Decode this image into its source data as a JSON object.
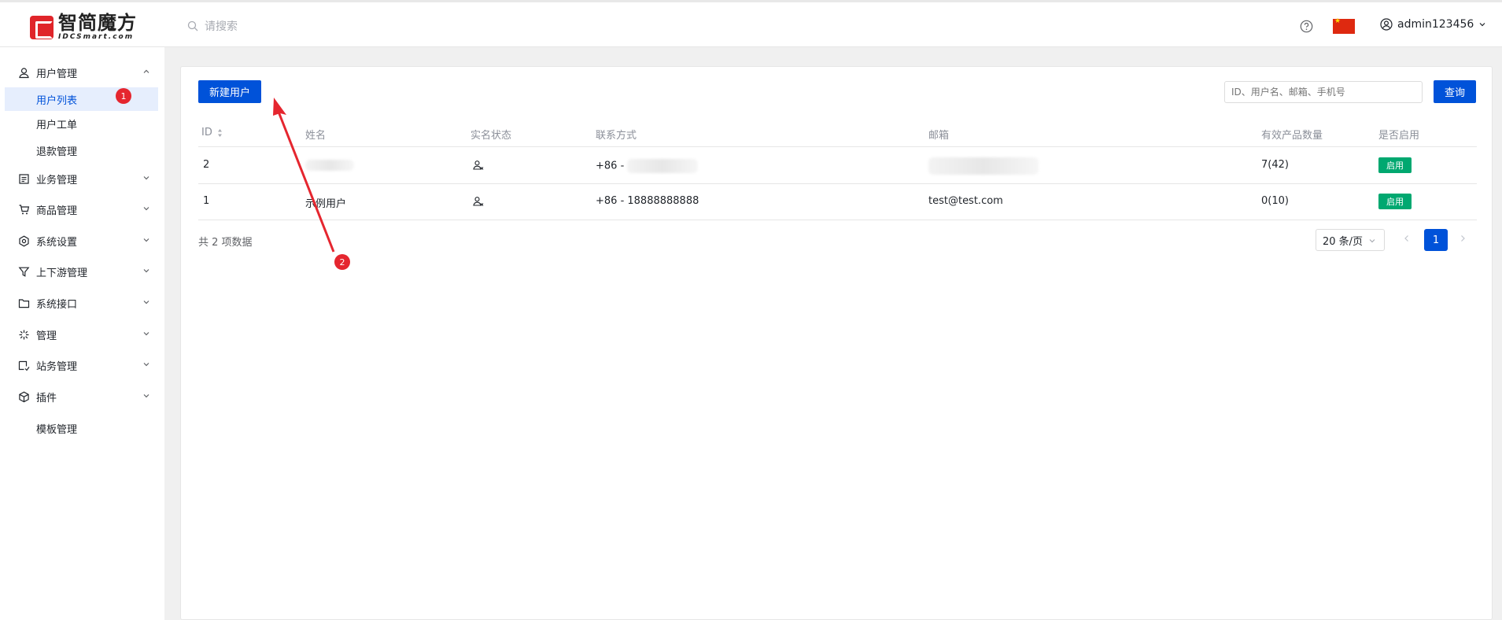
{
  "brand": {
    "name_cn": "智简魔方",
    "name_en": "IDCSmart.com"
  },
  "topbar": {
    "search_placeholder": "请搜索",
    "username": "admin123456",
    "help_icon": "question-circle-icon",
    "flag_icon": "china-flag-icon"
  },
  "sidebar": {
    "groups": [
      {
        "label": "用户管理",
        "icon": "user-icon",
        "expanded": true,
        "children": [
          {
            "label": "用户列表",
            "active": true,
            "badge": "1"
          },
          {
            "label": "用户工单"
          },
          {
            "label": "退款管理"
          }
        ]
      },
      {
        "label": "业务管理",
        "icon": "list-icon"
      },
      {
        "label": "商品管理",
        "icon": "cart-icon"
      },
      {
        "label": "系统设置",
        "icon": "settings-icon"
      },
      {
        "label": "上下游管理",
        "icon": "filter-icon"
      },
      {
        "label": "系统接口",
        "icon": "folder-icon"
      },
      {
        "label": "管理",
        "icon": "sparkle-icon"
      },
      {
        "label": "站务管理",
        "icon": "station-icon"
      },
      {
        "label": "插件",
        "icon": "package-icon"
      },
      {
        "label": "模板管理"
      }
    ]
  },
  "toolbar": {
    "new_user_label": "新建用户",
    "filter_placeholder": "ID、用户名、邮箱、手机号",
    "query_label": "查询"
  },
  "table": {
    "columns": [
      "ID",
      "姓名",
      "实名状态",
      "联系方式",
      "邮箱",
      "有效产品数量",
      "是否启用"
    ],
    "rows": [
      {
        "id": "2",
        "name": "",
        "phone": "+86 - ",
        "email": "",
        "products": "7(42)",
        "status": "启用"
      },
      {
        "id": "1",
        "name": "示例用户",
        "phone": "+86 - 18888888888",
        "email": "test@test.com",
        "products": "0(10)",
        "status": "启用"
      }
    ]
  },
  "pagination": {
    "total_text": "共 2 项数据",
    "page_size": "20 条/页",
    "current_page": "1"
  },
  "annotations": {
    "marker_1": "1",
    "marker_2": "2",
    "color": "#e5262f"
  },
  "colors": {
    "primary": "#0052d9",
    "success": "#00a870",
    "danger": "#e5262f"
  }
}
